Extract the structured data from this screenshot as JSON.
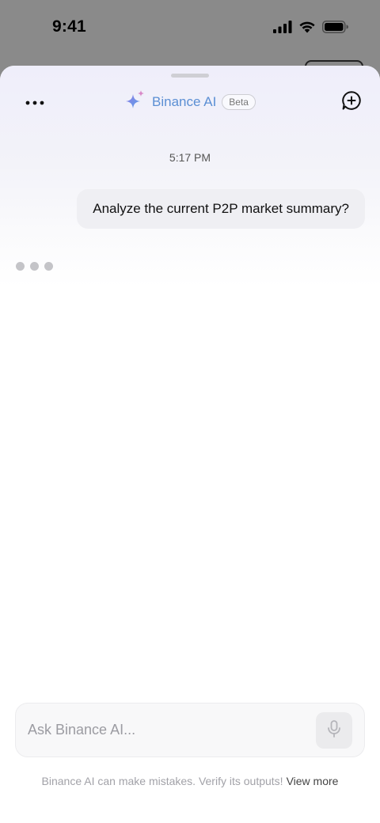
{
  "status_bar": {
    "time": "9:41",
    "icons": [
      "cellular-signal-icon",
      "wifi-icon",
      "battery-icon"
    ]
  },
  "header": {
    "title": "Binance AI",
    "badge": "Beta",
    "icons": [
      "more-horizontal-icon",
      "sparkle-icon",
      "new-chat-icon"
    ]
  },
  "chat": {
    "timestamp": "5:17 PM",
    "messages": [
      {
        "role": "user",
        "text": "Analyze the current P2P market summary?"
      }
    ],
    "assistant_typing": true
  },
  "composer": {
    "placeholder": "Ask Binance AI...",
    "value": "",
    "mic_icon": "microphone-icon"
  },
  "footer": {
    "disclaimer": "Binance AI can make mistakes. Verify its outputs!",
    "link": "View more"
  },
  "colors": {
    "title": "#5b8fd4",
    "sparkle_primary": "#6b8fe6",
    "sparkle_secondary": "#d889c8",
    "bubble": "#efeff3",
    "overlay": "#8a8a8a"
  }
}
